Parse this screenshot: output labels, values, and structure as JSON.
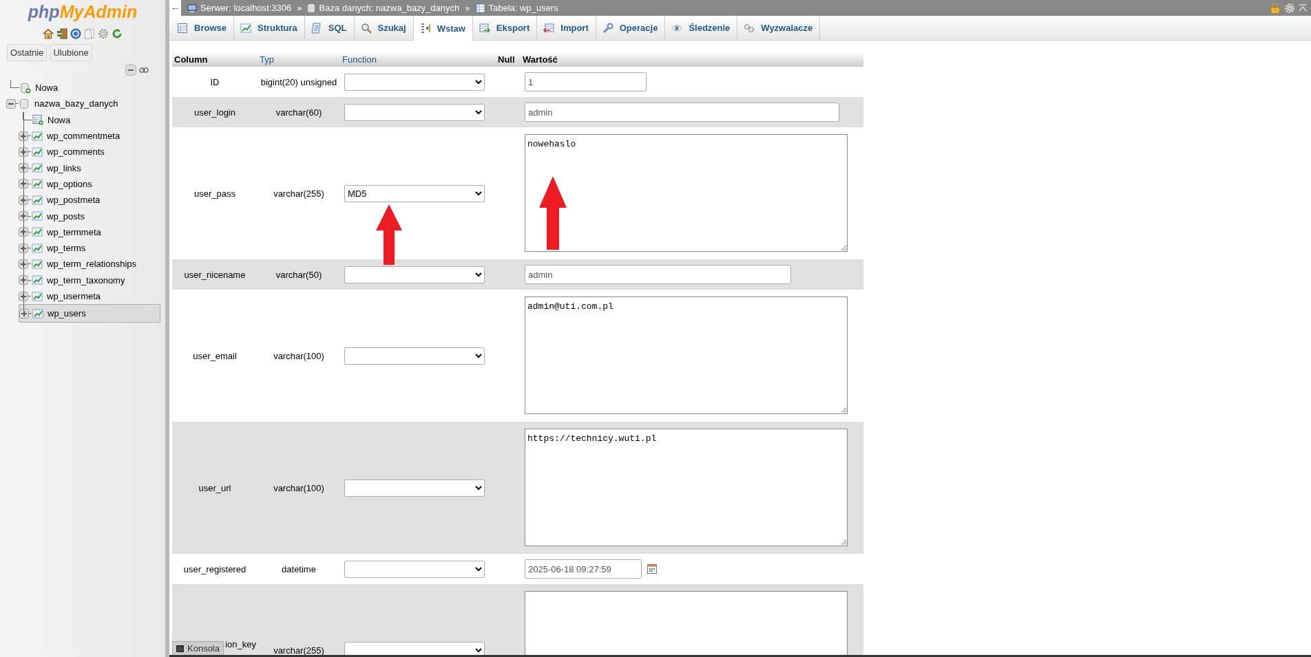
{
  "sidebar": {
    "logo": {
      "prefix": "php",
      "suffix": "MyAdmin"
    },
    "buttons": [
      {
        "label": "Ostatnie"
      },
      {
        "label": "Ulubione"
      }
    ],
    "tree": [
      {
        "label": "Nowa",
        "kind": "new-database",
        "selected": false
      },
      {
        "label": "nazwa_bazy_danych",
        "kind": "database",
        "expanded": true,
        "selected": false,
        "children": [
          {
            "label": "Nowa",
            "kind": "new-table",
            "selected": false
          },
          {
            "label": "wp_commentmeta",
            "kind": "table",
            "expanded": false,
            "selected": false
          },
          {
            "label": "wp_comments",
            "kind": "table",
            "expanded": false,
            "selected": false
          },
          {
            "label": "wp_links",
            "kind": "table",
            "expanded": false,
            "selected": false
          },
          {
            "label": "wp_options",
            "kind": "table",
            "expanded": false,
            "selected": false
          },
          {
            "label": "wp_postmeta",
            "kind": "table",
            "expanded": false,
            "selected": false
          },
          {
            "label": "wp_posts",
            "kind": "table",
            "expanded": false,
            "selected": false
          },
          {
            "label": "wp_termmeta",
            "kind": "table",
            "expanded": false,
            "selected": false
          },
          {
            "label": "wp_terms",
            "kind": "table",
            "expanded": false,
            "selected": false
          },
          {
            "label": "wp_term_relationships",
            "kind": "table",
            "expanded": false,
            "selected": false
          },
          {
            "label": "wp_term_taxonomy",
            "kind": "table",
            "expanded": false,
            "selected": false
          },
          {
            "label": "wp_usermeta",
            "kind": "table",
            "expanded": false,
            "selected": false
          },
          {
            "label": "wp_users",
            "kind": "table",
            "expanded": false,
            "selected": true
          }
        ]
      }
    ]
  },
  "topbar": {
    "back": "←",
    "breadcrumbs": [
      {
        "kind": "server",
        "text": "Serwer: localhost:3306",
        "separator": "»"
      },
      {
        "kind": "database",
        "text": "Baza danych: nazwa_bazy_danych",
        "separator": "»"
      },
      {
        "kind": "table",
        "text": "Tabela: wp_users"
      }
    ]
  },
  "tabs": [
    {
      "label": "Browse",
      "kind": "browse",
      "selected": false
    },
    {
      "label": "Struktura",
      "kind": "structure",
      "selected": false
    },
    {
      "label": "SQL",
      "kind": "sql",
      "selected": false
    },
    {
      "label": "Szukaj",
      "kind": "search",
      "selected": false
    },
    {
      "label": "Wstaw",
      "kind": "insert",
      "selected": true
    },
    {
      "label": "Eksport",
      "kind": "export",
      "selected": false
    },
    {
      "label": "Import",
      "kind": "import",
      "selected": false
    },
    {
      "label": "Operacje",
      "kind": "operations",
      "selected": false
    },
    {
      "label": "Śledzenie",
      "kind": "tracking",
      "selected": false
    },
    {
      "label": "Wyzwalacze",
      "kind": "triggers",
      "selected": false
    }
  ],
  "table": {
    "columns": [
      {
        "label": "Column",
        "link": false
      },
      {
        "label": "Typ",
        "link": true
      },
      {
        "label": "Function",
        "link": true
      },
      {
        "label": "Null",
        "link": false
      },
      {
        "label": "Wartość",
        "link": false
      }
    ],
    "rows": [
      {
        "column": "ID",
        "type": "bigint(20) unsigned",
        "kind": "input",
        "value": "1"
      },
      {
        "column": "user_login",
        "type": "varchar(60)",
        "kind": "input",
        "value": "admin"
      },
      {
        "column": "user_pass",
        "type": "varchar(255)",
        "function": "MD5",
        "kind": "textarea",
        "value": "nowehaslo"
      },
      {
        "column": "user_nicename",
        "type": "varchar(50)",
        "kind": "input",
        "value": "admin"
      },
      {
        "column": "user_email",
        "type": "varchar(100)",
        "kind": "textarea",
        "value": "admin@uti.com.pl"
      },
      {
        "column": "user_url",
        "type": "varchar(100)",
        "kind": "textarea",
        "value": "https://technicy.wuti.pl"
      },
      {
        "column": "user_registered",
        "type": "datetime",
        "kind": "date",
        "value": "2025-06-18 09:27:59"
      },
      {
        "column": "ion_key",
        "type": "varchar(255)",
        "kind": "textarea"
      }
    ]
  },
  "console": {
    "label": "Konsola"
  }
}
